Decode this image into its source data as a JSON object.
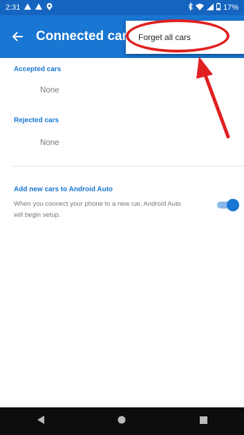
{
  "status_bar": {
    "time": "2:31",
    "battery": "17%"
  },
  "app_bar": {
    "title": "Connected cars"
  },
  "menu": {
    "forget_all_label": "Forget all cars"
  },
  "sections": {
    "accepted": {
      "header": "Accepted cars",
      "empty_text": "None"
    },
    "rejected": {
      "header": "Rejected cars",
      "empty_text": "None"
    }
  },
  "add_new": {
    "title": "Add new cars to Android Auto",
    "description": "When you connect your phone to a new car, Android Auto will begin setup.",
    "enabled": true
  },
  "colors": {
    "accent": "#1976d2",
    "status_bar": "#1565c0",
    "annotation": "#e02020",
    "nav_bar": "#0d0d0d"
  },
  "icons": [
    "warning-icon",
    "warning-icon",
    "location-icon",
    "bluetooth-icon",
    "wifi-icon",
    "signal-icon",
    "battery-icon",
    "back-arrow-icon",
    "nav-back-icon",
    "nav-home-icon",
    "nav-recents-icon"
  ]
}
